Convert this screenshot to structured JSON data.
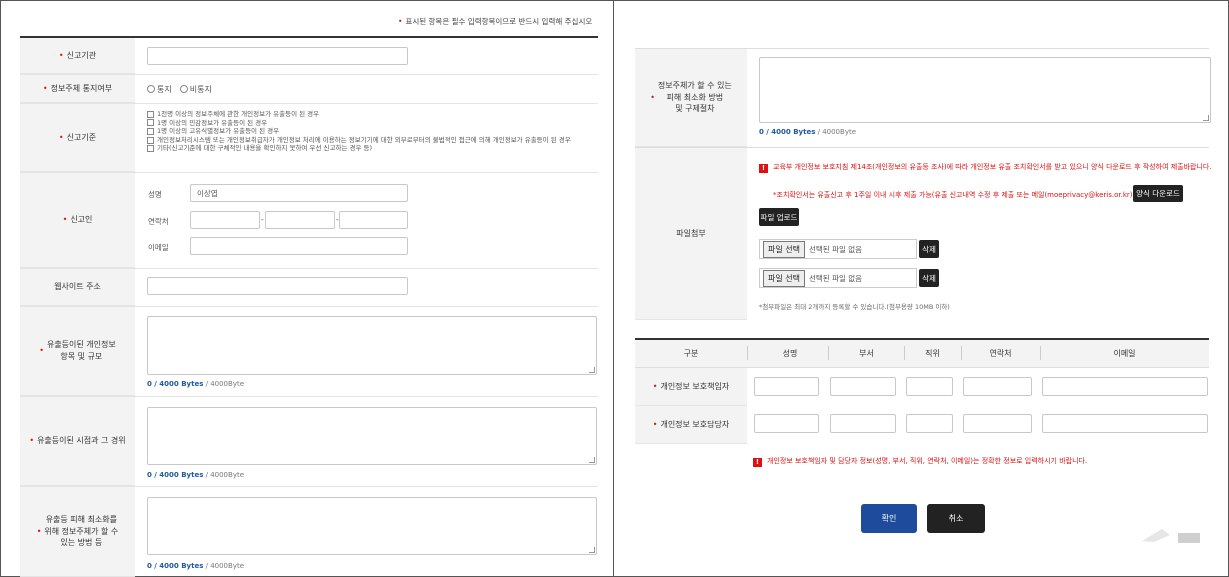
{
  "required_note": "표시된 항목은 필수 입력항목이므로 반드시 입력해 주십시오",
  "left": {
    "agency_label": "신고기관",
    "notify_label": "정보주체 통지여부",
    "notify_options": [
      "통지",
      "비통지"
    ],
    "criteria_label": "신고기준",
    "criteria_items": [
      "1천명 이상의 정보주체에 관한 개인정보가 유출등이 된 경우",
      "1명 이상의 민감정보가 유출등이 된 경우",
      "1명 이상의 고유식별정보가 유출등이 된 경우",
      "개인정보처리시스템 또는 개인정보취급자가 개인정보 처리에 이용하는 정보기기에 대한 외부로부터의 불법적인 접근에 의해 개인정보가 유출등이 된 경우",
      "기타(신고기준에 대한 구체적인 내용을 확인하지 못하여 우선 신고하는 경우 등)"
    ],
    "reporter_label": "신고인",
    "name_label": "성명",
    "name_value": "이상엽",
    "contact_label": "연락처",
    "email_label": "이메일",
    "website_label": "웹사이트 주소",
    "leaked_items_label_1": "유출등이된 개인정보",
    "leaked_items_label_2": "항목 및 규모",
    "timing_label": "유출등이된 시점과 그 경위",
    "min_label_1": "유출등 피해 최소화를",
    "min_label_2": "위해 정보주체가 할 수",
    "min_label_3": "있는 방법 등",
    "count_bold": "0 / 4000 Bytes",
    "count_rest": " / 4000Byte"
  },
  "right": {
    "remedy_label_1": "정보주체가 할 수 있는",
    "remedy_label_2": "피해 최소화 방법",
    "remedy_label_3": "및 구제절차",
    "count_bold": "0 / 4000 Bytes",
    "count_rest": " / 4000Byte",
    "attach_label": "파일첨부",
    "notice_1": "교육부 개인정보 보호지침 제14조(개인정보의 유출등 조사)에 따라 개인정보 유출 조치확인서를 받고 있으니 양식 다운로드 후 작성하여 제출바랍니다.",
    "notice_2": "*조치확인서는 유출신고 후 1주일 이내 시후 제출 가능(유출 신고내역 수정 후 제출 또는 메일(moeprivacy@keris.or.kr)제출)",
    "download_btn": "양식 다운로드",
    "upload_btn": "파일 업로드",
    "file_pick_btn": "파일 선택",
    "no_file_text": "선택된 파일 없음",
    "delete_btn": "삭제",
    "attach_note": "*첨부파일은 최대 2개까지 등록할 수 있습니다.(첨부용량 10MB 이하)",
    "table_headers": [
      "구분",
      "성명",
      "부서",
      "직위",
      "연락처",
      "이메일"
    ],
    "row_1_label": "개인정보 보호책임자",
    "row_2_label": "개인정보 보호담당자",
    "table_notice": "개인정보 보호책임자 및 담당자 정보(성명, 부서, 직위, 연락처, 이메일)는 정확한 정보로 입력하시기 바랍니다.",
    "confirm_btn": "확인",
    "cancel_btn": "취소"
  },
  "colors": {
    "required": "#dd1111",
    "confirm": "#1e4b9b",
    "dark_button": "#222222"
  }
}
